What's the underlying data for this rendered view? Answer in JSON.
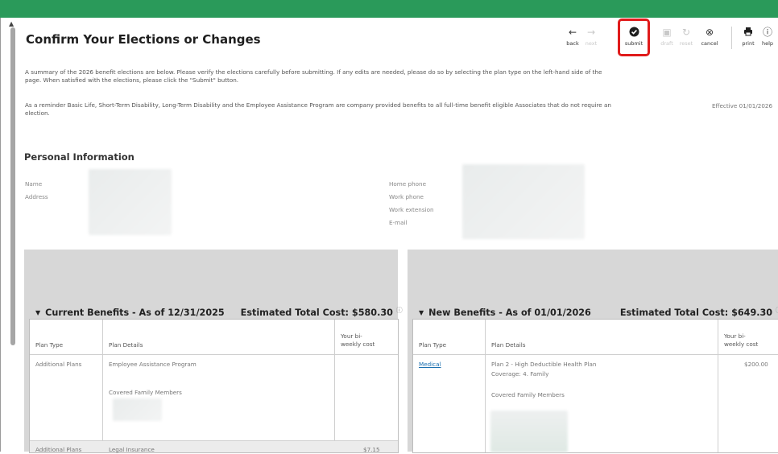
{
  "page_title": "Confirm Your Elections or Changes",
  "toolbar": {
    "back": "back",
    "next": "next",
    "submit": "submit",
    "draft": "draft",
    "reset": "reset",
    "cancel": "cancel",
    "print": "print",
    "help": "help"
  },
  "intro": {
    "p1_line1": "A summary of the 2026 benefit elections are below. Please verify the elections carefully before submitting. If any edits are needed, please do so by selecting the plan type on the left-hand side of the",
    "p1_line2": "page. When satisfied with the elections, please click the \"Submit\" button.",
    "p2_line1": "As a reminder Basic Life, Short-Term Disability, Long-Term Disability and the Employee Assistance Program are company provided benefits to all full-time benefit eligible Associates that do not require an",
    "p2_line2": "election.",
    "effective": "Effective 01/01/2026"
  },
  "personal": {
    "heading": "Personal Information",
    "name_label": "Name",
    "address_label": "Address",
    "home_phone_label": "Home phone",
    "work_phone_label": "Work phone",
    "work_extension_label": "Work extension",
    "email_label": "E-mail"
  },
  "current": {
    "title": "Current Benefits - As of 12/31/2025",
    "cost": "Estimated Total Cost: $580.30",
    "col_plan_type": "Plan Type",
    "col_plan_details": "Plan Details",
    "col_cost_l1": "Your bi-",
    "col_cost_l2": "weekly cost",
    "rows": [
      {
        "plan_type": "Additional Plans",
        "details": "Employee Assistance Program",
        "covered": "Covered Family Members",
        "cost": ""
      },
      {
        "plan_type": "Additional Plans",
        "details": "Legal Insurance",
        "covered": "",
        "cost": "$7.15"
      }
    ]
  },
  "new": {
    "title": "New Benefits - As of 01/01/2026",
    "cost": "Estimated Total Cost: $649.30",
    "col_plan_type": "Plan Type",
    "col_plan_details": "Plan Details",
    "col_cost_l1": "Your bi-",
    "col_cost_l2": "weekly cost",
    "rows": [
      {
        "plan_type": "Medical",
        "details": "Plan 2 - High Deductible Health Plan",
        "coverage": "Coverage:  4. Family",
        "covered": "Covered Family Members",
        "cost": "$200.00"
      }
    ]
  },
  "colors": {
    "topbar": "#2a9a5a",
    "highlight": "#e01b1b",
    "link": "#1a6fb0",
    "panel": "#d7d7d7"
  }
}
